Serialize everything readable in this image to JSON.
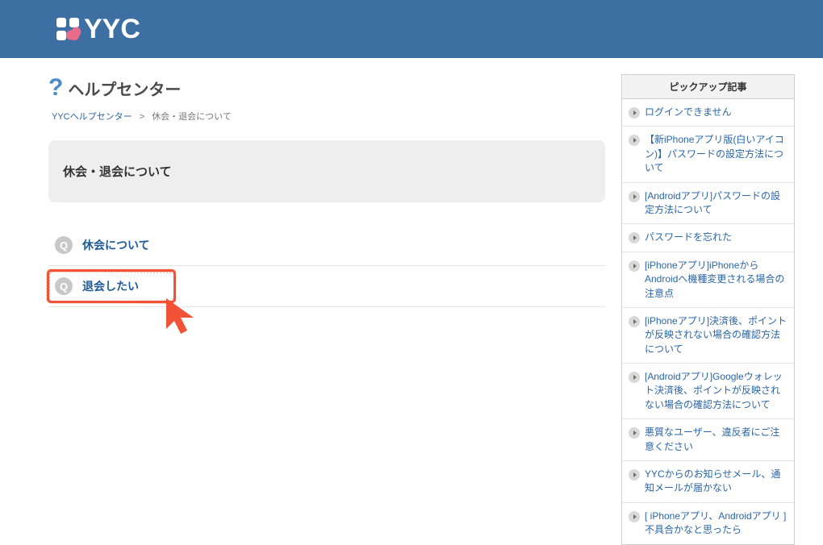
{
  "brand": "YYC",
  "page_title": "ヘルプセンター",
  "breadcrumb": {
    "home": "YYCヘルプセンター",
    "sep": ">",
    "current": "休会・退会について"
  },
  "section_title": "休会・退会について",
  "questions": [
    {
      "label": "休会について"
    },
    {
      "label": "退会したい"
    }
  ],
  "pickup": {
    "header": "ピックアップ記事",
    "items": [
      "ログインできません",
      "【新iPhoneアプリ版(白いアイコン)】パスワードの設定方法について",
      "[Androidアプリ]パスワードの設定方法について",
      "パスワードを忘れた",
      "[iPhoneアプリ]iPhoneからAndroidへ機種変更される場合の注意点",
      "[iPhoneアプリ]決済後、ポイントが反映されない場合の確認方法について",
      "[Androidアプリ]Googleウォレット決済後、ポイントが反映されない場合の確認方法について",
      "悪質なユーザー、違反者にご注意ください",
      "YYCからのお知らせメール、通知メールが届かない",
      "[ iPhoneアプリ、Androidアプリ ]　不具合かなと思ったら"
    ]
  }
}
